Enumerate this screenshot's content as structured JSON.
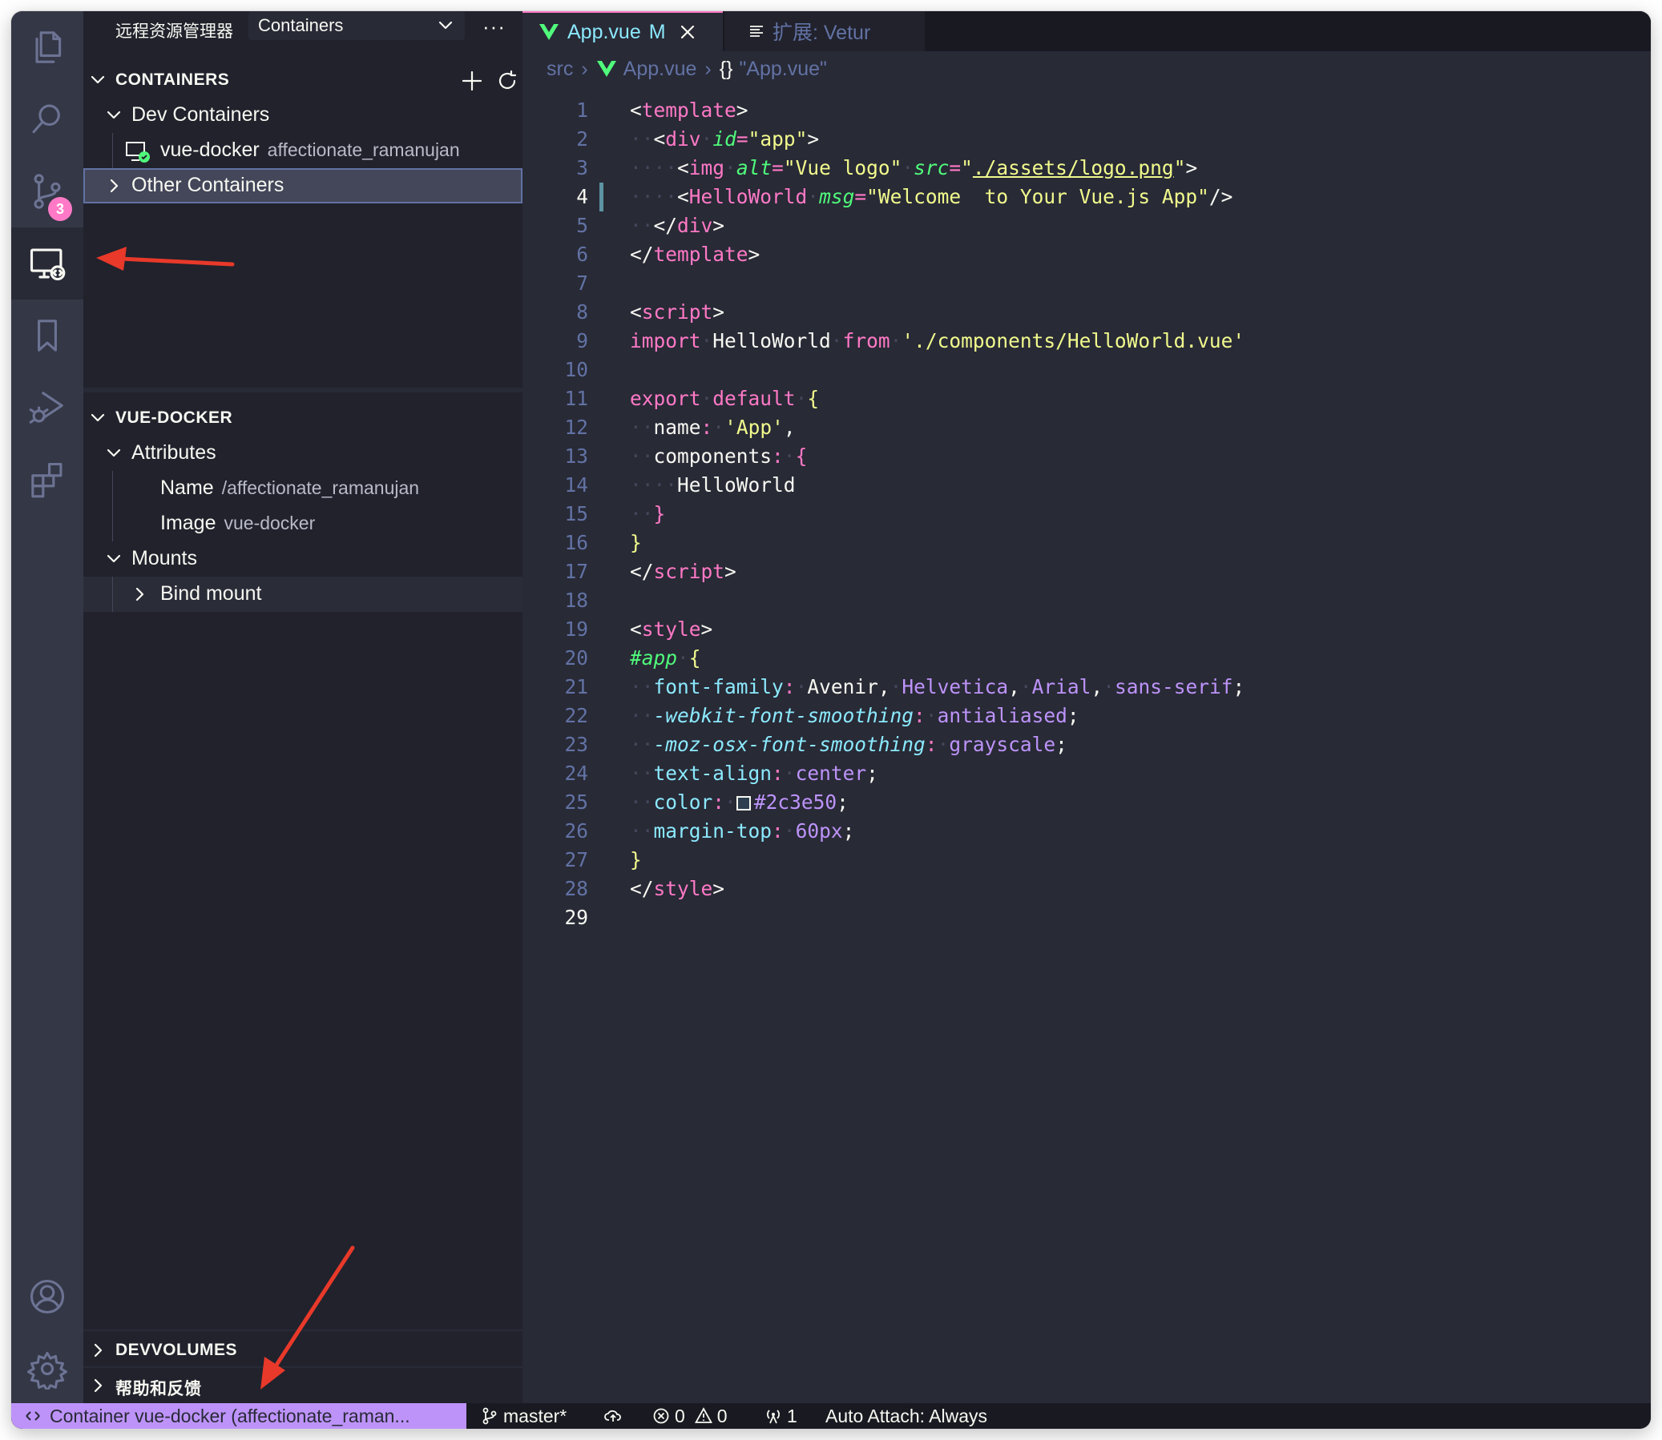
{
  "sidebar": {
    "title": "远程资源管理器",
    "view_select": "Containers",
    "more_label": "···",
    "containers_section": {
      "title": "CONTAINERS",
      "dev_containers": "Dev Containers",
      "container_name": "vue-docker",
      "container_desc": "affectionate_ramanujan",
      "other_containers": "Other Containers"
    },
    "details_section": {
      "title": "VUE-DOCKER",
      "attributes": "Attributes",
      "name_label": "Name",
      "name_value": "/affectionate_ramanujan",
      "image_label": "Image",
      "image_value": "vue-docker",
      "mounts": "Mounts",
      "bind_mount": "Bind mount"
    },
    "devvolumes": "DEVVOLUMES",
    "help": "帮助和反馈"
  },
  "activity_bar": {
    "icons": [
      "files-icon",
      "search-icon",
      "source-control-icon",
      "remote-explorer-icon",
      "bookmark-icon",
      "run-debug-icon",
      "extensions-icon",
      "account-icon",
      "settings-gear-icon"
    ],
    "scm_badge": "3"
  },
  "tabs": {
    "active_label": "App.vue",
    "active_modified": "M",
    "second_label": "扩展: Vetur"
  },
  "breadcrumb": {
    "folder": "src",
    "file": "App.vue",
    "symbol": "\"App.vue\"",
    "symbol_braces": "{}"
  },
  "editor": {
    "line_numbers": [
      "1",
      "2",
      "3",
      "4",
      "5",
      "6",
      "7",
      "8",
      "9",
      "10",
      "11",
      "12",
      "13",
      "14",
      "15",
      "16",
      "17",
      "18",
      "19",
      "20",
      "21",
      "22",
      "23",
      "24",
      "25",
      "26",
      "27",
      "28",
      "29"
    ],
    "code": {
      "l1_open": "<",
      "l1_tag": "template",
      "l1_close": ">",
      "l2_tag": "div",
      "l2_attr": "id",
      "l2_val": "\"app\"",
      "l3_tag": "img",
      "l3_attr1": "alt",
      "l3_val1": "\"Vue logo\"",
      "l3_attr2": "src",
      "l3_val2": "./assets/logo.png",
      "l4_tag": "HelloWorld",
      "l4_attr": "msg",
      "l4_val": "\"Welcome  to Your Vue.js App\"",
      "l5_tag": "div",
      "l6_tag": "template",
      "l8_tag": "script",
      "l9_import": "import",
      "l9_name": "HelloWorld",
      "l9_from": "from",
      "l9_path": "'./components/HelloWorld.vue'",
      "l11_export": "export",
      "l11_default": "default",
      "l12_key": "name",
      "l12_val": "'App'",
      "l13_key": "components",
      "l14_name": "HelloWorld",
      "l17_tag": "script",
      "l19_tag": "style",
      "l20_sel": "#app",
      "l21_prop": "font-family",
      "l21_v1": "Avenir",
      "l21_v2": "Helvetica",
      "l21_v3": "Arial",
      "l21_v4": "sans-serif",
      "l22_prop": "-webkit-font-smoothing",
      "l22_val": "antialiased",
      "l23_prop": "-moz-osx-font-smoothing",
      "l23_val": "grayscale",
      "l24_prop": "text-align",
      "l24_val": "center",
      "l25_prop": "color",
      "l25_val": "#2c3e50",
      "l26_prop": "margin-top",
      "l26_val": "60px",
      "l28_tag": "style"
    },
    "swatch_color": "#2c3e50"
  },
  "status_bar": {
    "remote": "Container vue-docker (affectionate_raman...",
    "branch": "master*",
    "errors": "0",
    "warnings": "0",
    "ports": "1",
    "auto_attach": "Auto Attach: Always"
  },
  "colors": {
    "background": "#282a36",
    "sidebar": "#21222c",
    "activity": "#343746",
    "accent_pink": "#ff79c6",
    "remote_purple": "#bd93f9",
    "annotation_red": "#e8392a"
  }
}
